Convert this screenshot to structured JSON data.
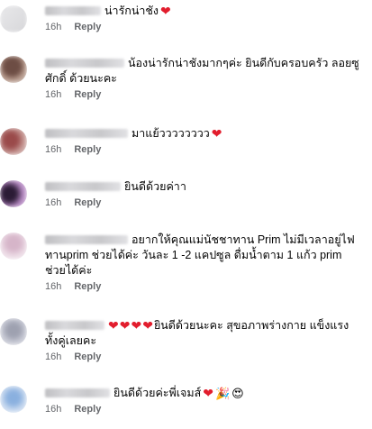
{
  "comments": [
    {
      "avatar_icon": "user-avatar-blurred",
      "name_width": 96,
      "text": "น่ารักน่าชัง",
      "hearts": 1,
      "emoji": "",
      "time": "16h",
      "reply": "Reply"
    },
    {
      "avatar_icon": "user-avatar-blurred",
      "name_width": 92,
      "text": "น้องน่ารักน่าชังมากๆค่ะ ยินดีกับครอบครัว ลอยซูศักดิ์ ด้วยนะคะ",
      "hearts": 0,
      "emoji": "",
      "time": "16h",
      "reply": "Reply"
    },
    {
      "avatar_icon": "user-avatar-blurred",
      "name_width": 100,
      "text": "มาแย้วววววววว",
      "hearts": 1,
      "emoji": "",
      "time": "16h",
      "reply": "Reply"
    },
    {
      "avatar_icon": "user-avatar-blurred",
      "name_width": 88,
      "text": "ยินดีด้วยค่าา",
      "hearts": 0,
      "emoji": "",
      "time": "16h",
      "reply": "Reply"
    },
    {
      "avatar_icon": "user-avatar-blurred",
      "name_width": 98,
      "text": "อยากให้คุณแม่นัชชาทาน Prim ไม่มีเวลาอยู่ไฟ ทานprim ช่วยได้ค่ะ วันละ 1 -2 แคปซูล ดื่มน้ำตาม 1 แก้ว prim ช่วยได้ค่ะ",
      "hearts": 0,
      "emoji": "",
      "time": "16h",
      "reply": "Reply"
    },
    {
      "avatar_icon": "user-avatar-blurred",
      "name_width": 72,
      "text": "ยินดีด้วยนะคะ สุขอภาพร่างกาย แข็งแรง ทั้งคู่เลยคะ",
      "hearts": 4,
      "emoji": "",
      "time": "16h",
      "reply": "Reply"
    },
    {
      "avatar_icon": "user-avatar-blurred",
      "name_width": 78,
      "text": "ยินดีด้วยค่ะพี่เจมส์",
      "hearts": 1,
      "emoji": "🎉😍",
      "time": "16h",
      "reply": "Reply"
    }
  ]
}
